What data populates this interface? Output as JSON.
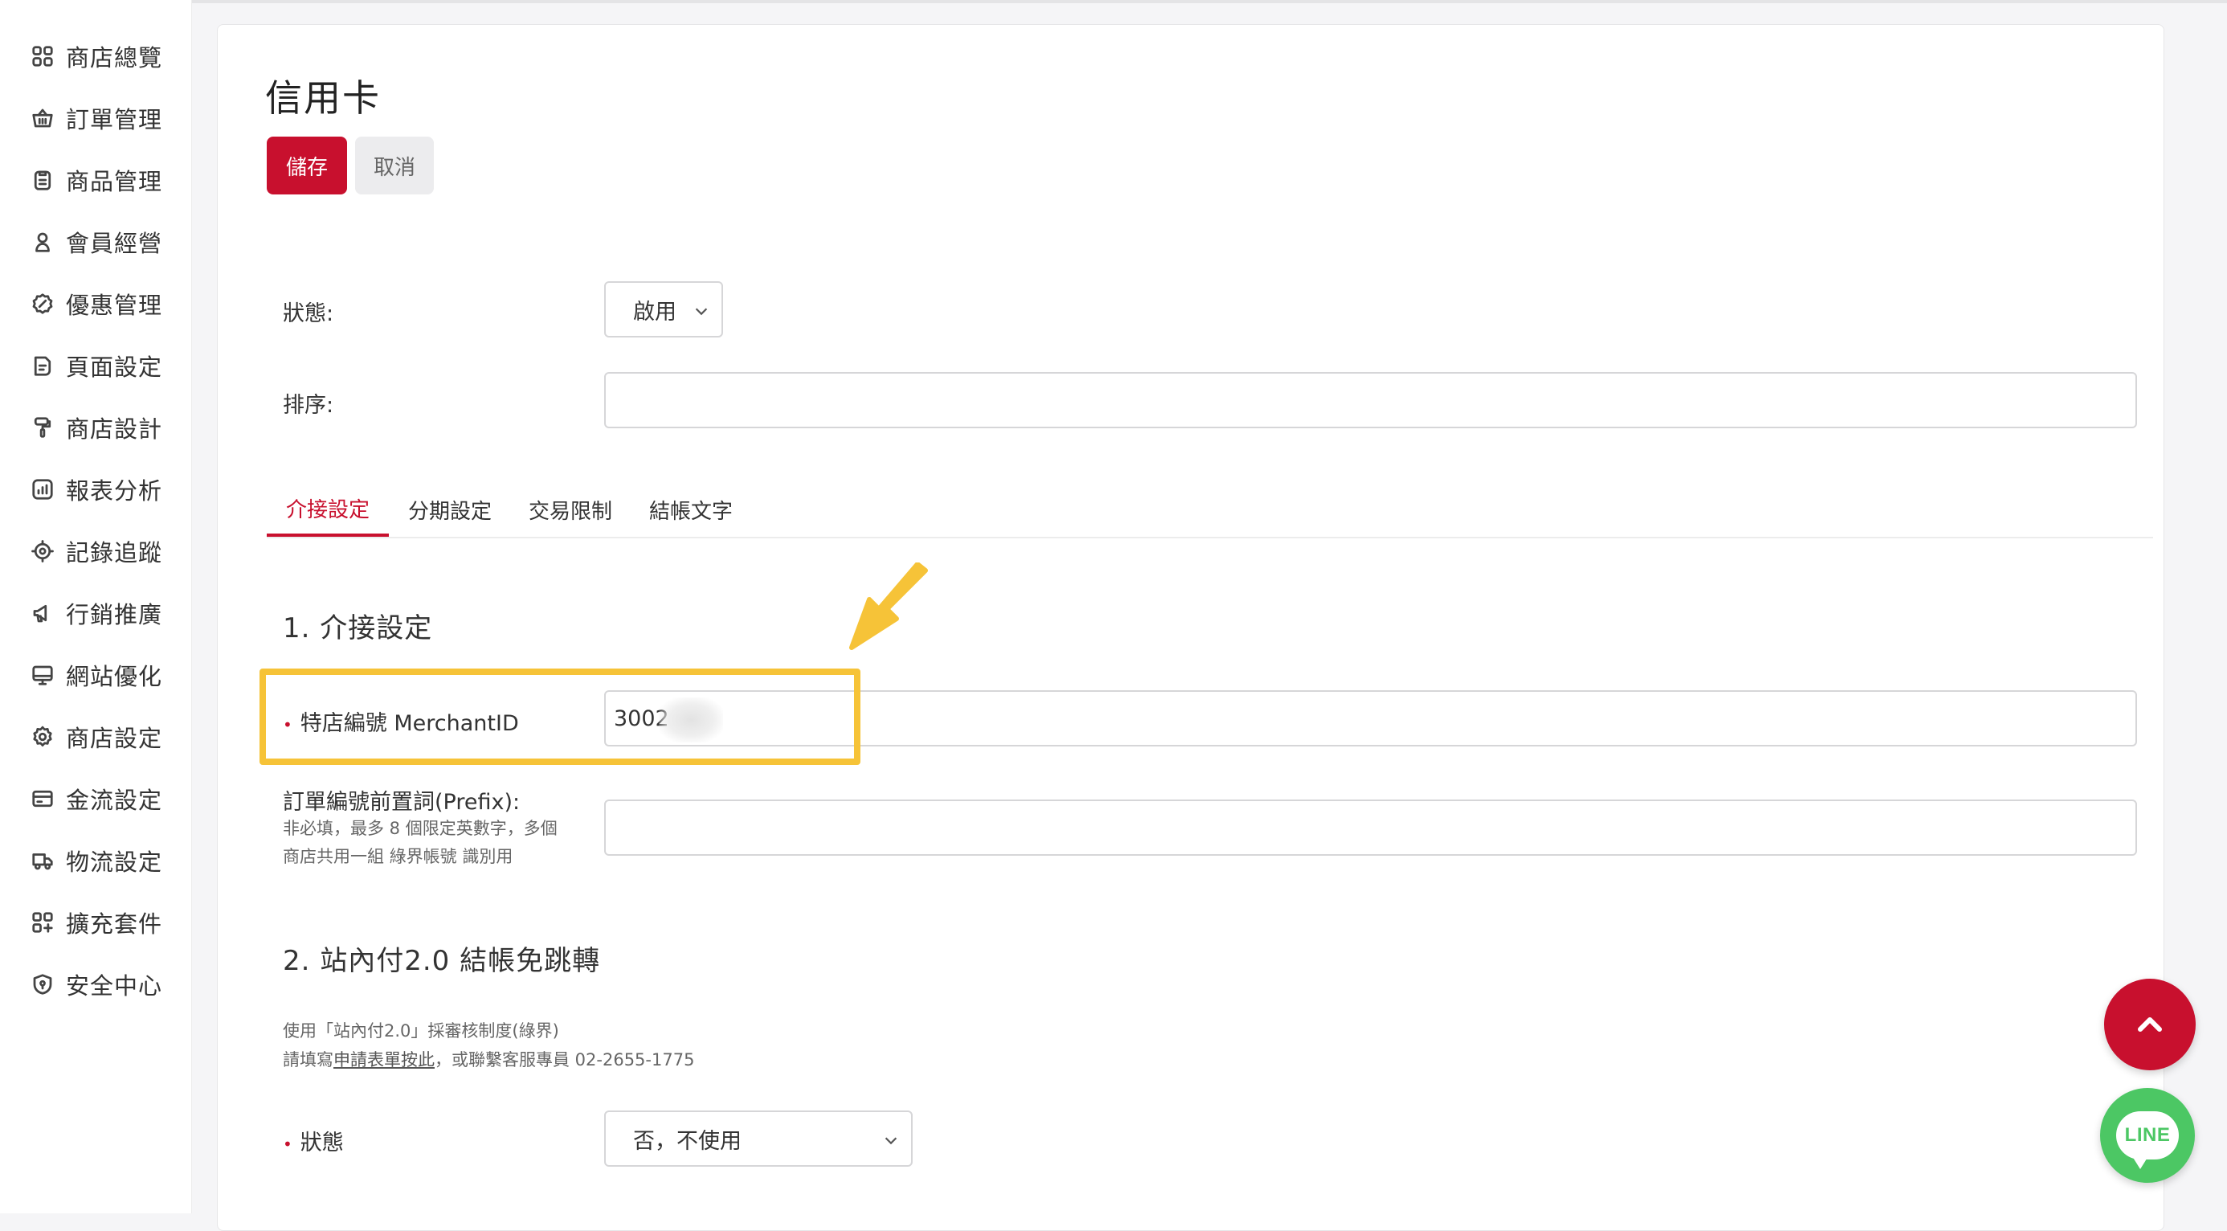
{
  "sidebar": {
    "items": [
      {
        "label": "商店總覽",
        "icon": "grid-icon"
      },
      {
        "label": "訂單管理",
        "icon": "basket-icon"
      },
      {
        "label": "商品管理",
        "icon": "clipboard-icon"
      },
      {
        "label": "會員經營",
        "icon": "user-icon"
      },
      {
        "label": "優惠管理",
        "icon": "badge-icon"
      },
      {
        "label": "頁面設定",
        "icon": "page-icon"
      },
      {
        "label": "商店設計",
        "icon": "paint-roller-icon"
      },
      {
        "label": "報表分析",
        "icon": "chart-icon"
      },
      {
        "label": "記錄追蹤",
        "icon": "target-icon"
      },
      {
        "label": "行銷推廣",
        "icon": "megaphone-icon"
      },
      {
        "label": "網站優化",
        "icon": "monitor-icon"
      },
      {
        "label": "商店設定",
        "icon": "gear-icon"
      },
      {
        "label": "金流設定",
        "icon": "credit-card-icon"
      },
      {
        "label": "物流設定",
        "icon": "truck-icon"
      },
      {
        "label": "擴充套件",
        "icon": "plugin-icon"
      },
      {
        "label": "安全中心",
        "icon": "shield-icon"
      }
    ]
  },
  "page": {
    "title": "信用卡",
    "save_label": "儲存",
    "cancel_label": "取消"
  },
  "form": {
    "status_label": "狀態:",
    "status_value": "啟用",
    "order_label": "排序:",
    "order_value": ""
  },
  "tabs": [
    {
      "label": "介接設定",
      "active": true
    },
    {
      "label": "分期設定",
      "active": false
    },
    {
      "label": "交易限制",
      "active": false
    },
    {
      "label": "結帳文字",
      "active": false
    }
  ],
  "section1": {
    "title": "1. 介接設定",
    "merchant_label": "特店編號 MerchantID",
    "merchant_value": "3002",
    "prefix_label": "訂單編號前置詞(Prefix):",
    "prefix_help_line1": "非必填，最多 8 個限定英數字，多個",
    "prefix_help_line2": "商店共用一組 綠界帳號 識別用",
    "prefix_value": ""
  },
  "section2": {
    "title": "2. 站內付2.0 結帳免跳轉",
    "desc_line1": "使用「站內付2.0」採審核制度(綠界)",
    "desc_line2_prefix": "請填寫",
    "desc_line2_link": "申請表單按此",
    "desc_line2_suffix": "，或聯繫客服專員 02-2655-1775",
    "status_label": "狀態",
    "status_value": "否，不使用"
  },
  "floating": {
    "line_label": "LINE"
  },
  "colors": {
    "accent": "#c8102e",
    "highlight": "#f6c338",
    "line_green": "#4cc764"
  }
}
